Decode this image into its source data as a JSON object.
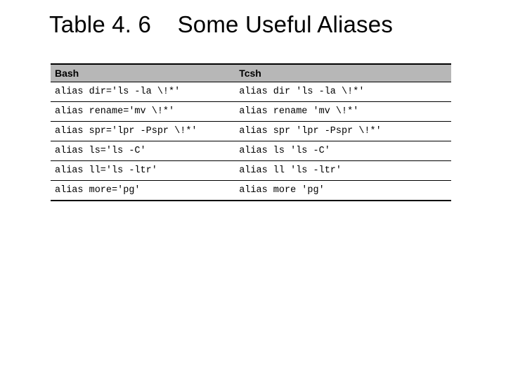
{
  "title": "Table 4. 6    Some Useful Aliases",
  "headers": {
    "bash": "Bash",
    "tcsh": "Tcsh"
  },
  "rows": [
    {
      "bash": "alias dir='ls -la \\!*'",
      "tcsh": "alias dir 'ls -la \\!*'"
    },
    {
      "bash": "alias rename='mv \\!*'",
      "tcsh": "alias rename 'mv \\!*'"
    },
    {
      "bash": "alias spr='lpr -Pspr \\!*'",
      "tcsh": "alias spr 'lpr -Pspr \\!*'"
    },
    {
      "bash": "alias ls='ls -C'",
      "tcsh": "alias ls 'ls -C'"
    },
    {
      "bash": "alias ll='ls -ltr'",
      "tcsh": "alias ll 'ls -ltr'"
    },
    {
      "bash": "alias more='pg'",
      "tcsh": "alias more 'pg'"
    }
  ],
  "chart_data": {
    "type": "table",
    "title": "Table 4.6 Some Useful Aliases",
    "columns": [
      "Bash",
      "Tcsh"
    ],
    "rows": [
      [
        "alias dir='ls -la \\!*'",
        "alias dir 'ls -la \\!*'"
      ],
      [
        "alias rename='mv \\!*'",
        "alias rename 'mv \\!*'"
      ],
      [
        "alias spr='lpr -Pspr \\!*'",
        "alias spr 'lpr -Pspr \\!*'"
      ],
      [
        "alias ls='ls -C'",
        "alias ls 'ls -C'"
      ],
      [
        "alias ll='ls -ltr'",
        "alias ll 'ls -ltr'"
      ],
      [
        "alias more='pg'",
        "alias more 'pg'"
      ]
    ]
  }
}
